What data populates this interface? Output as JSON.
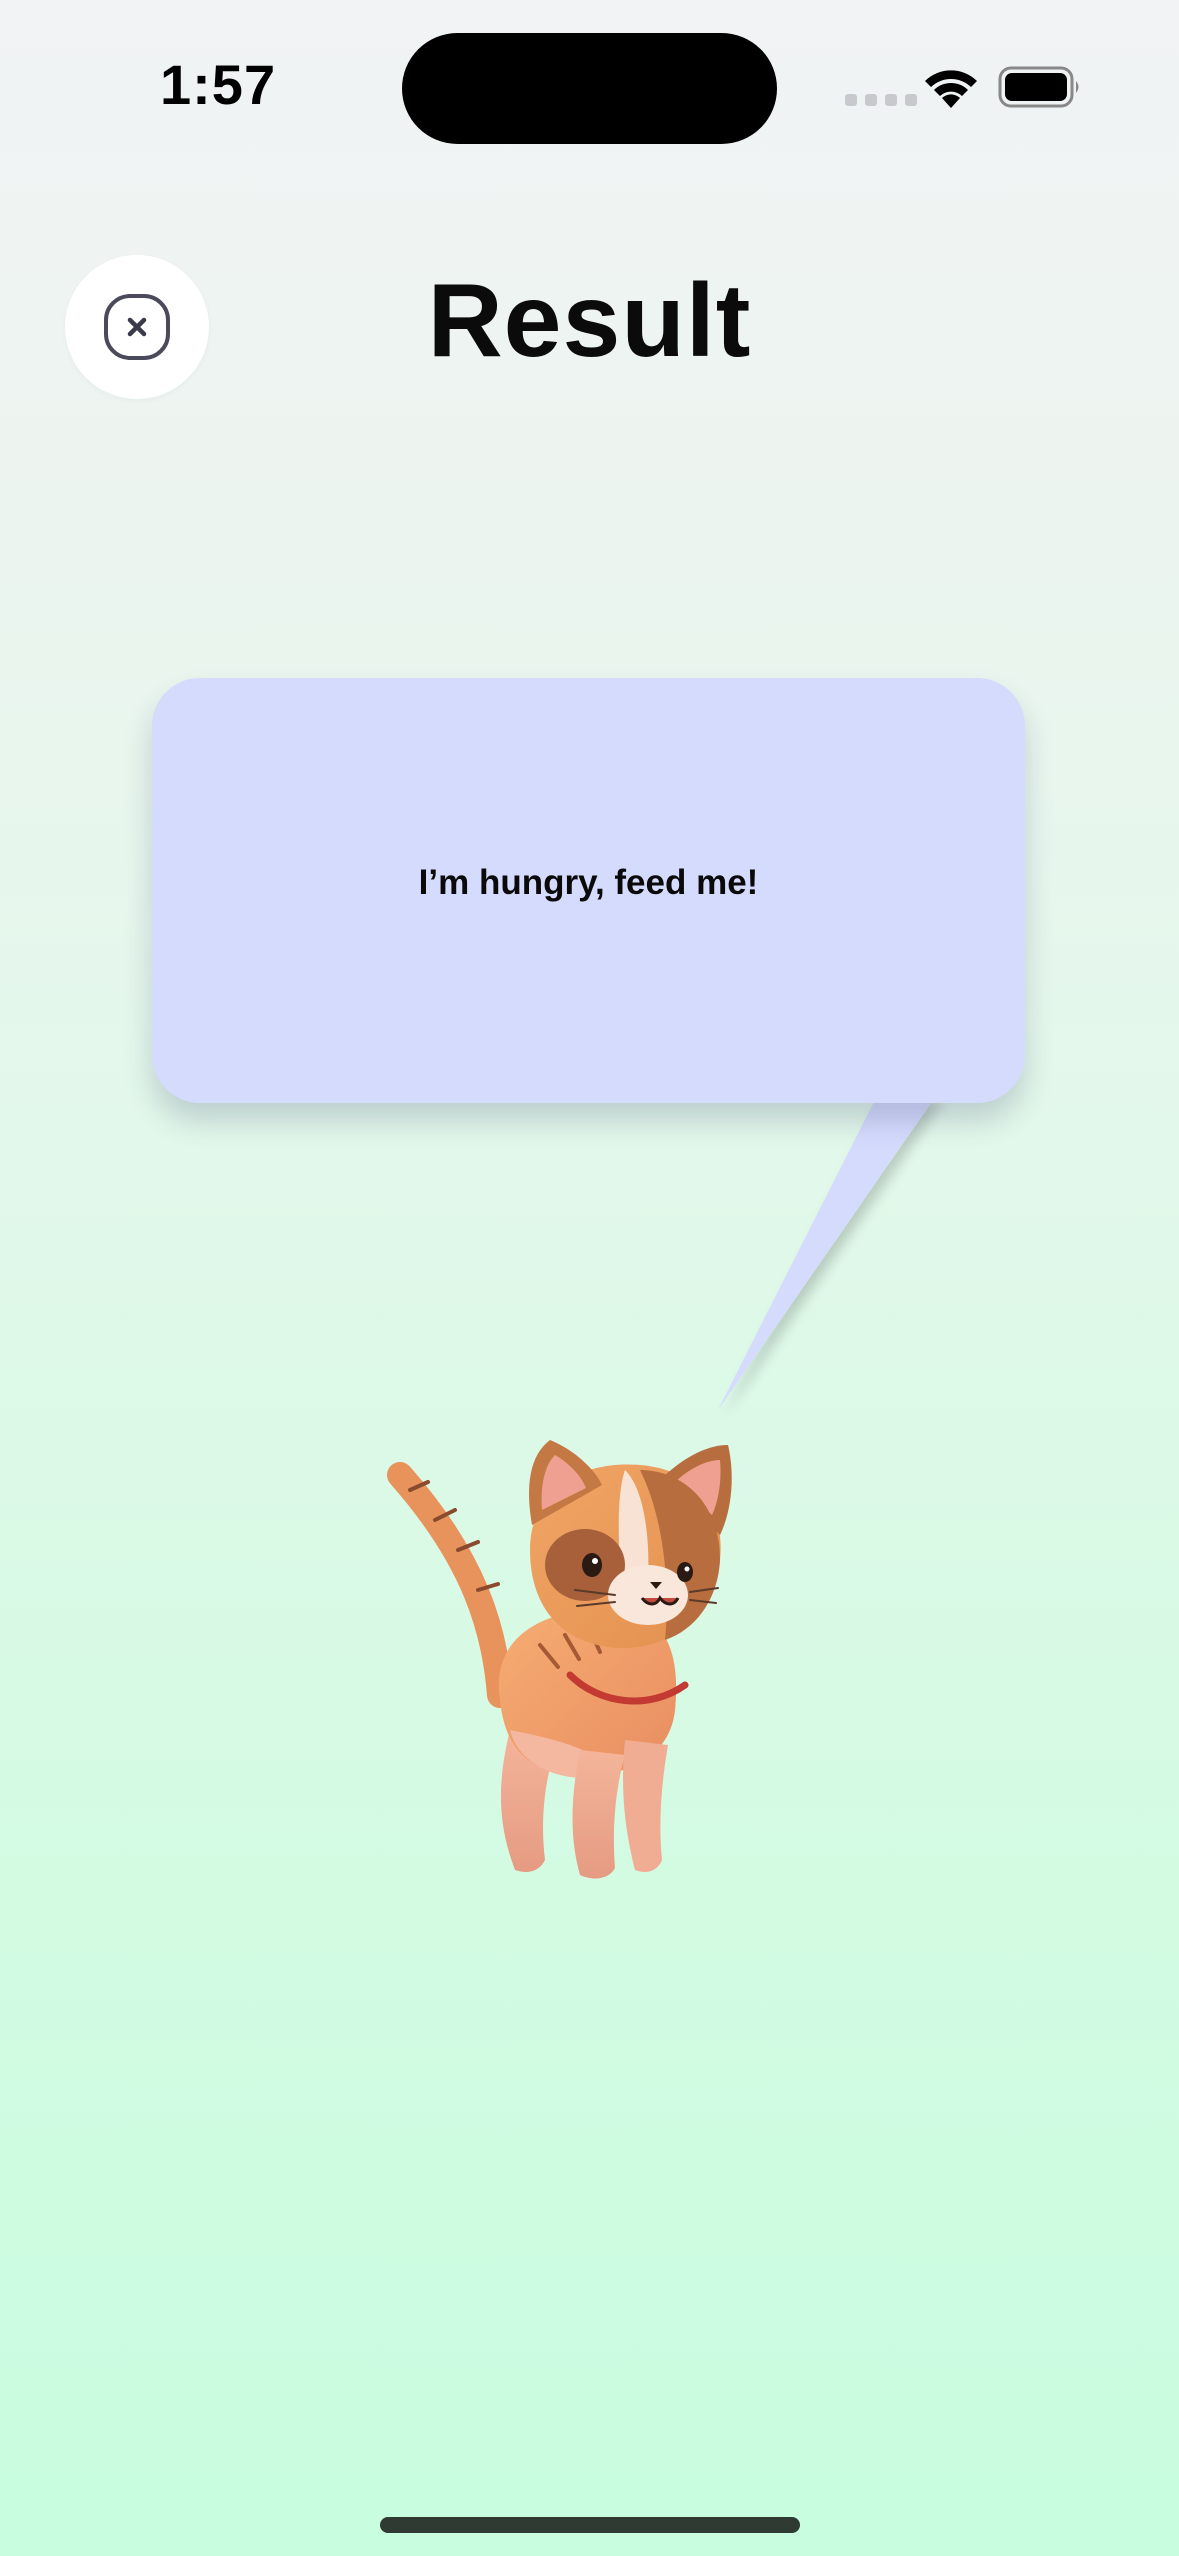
{
  "status_bar": {
    "time": "1:57",
    "icons": [
      "cellular-icon",
      "wifi-icon",
      "battery-icon"
    ]
  },
  "header": {
    "title": "Result",
    "close_icon": "close-icon"
  },
  "bubble": {
    "text": "I’m hungry, feed me!"
  },
  "colors": {
    "bubble": "#d5dbfd",
    "background_top": "#f1f3f5",
    "background_bottom": "#c8fde0",
    "close_icon_stroke": "#4a4a5a"
  },
  "illustration": "cat-illustration"
}
